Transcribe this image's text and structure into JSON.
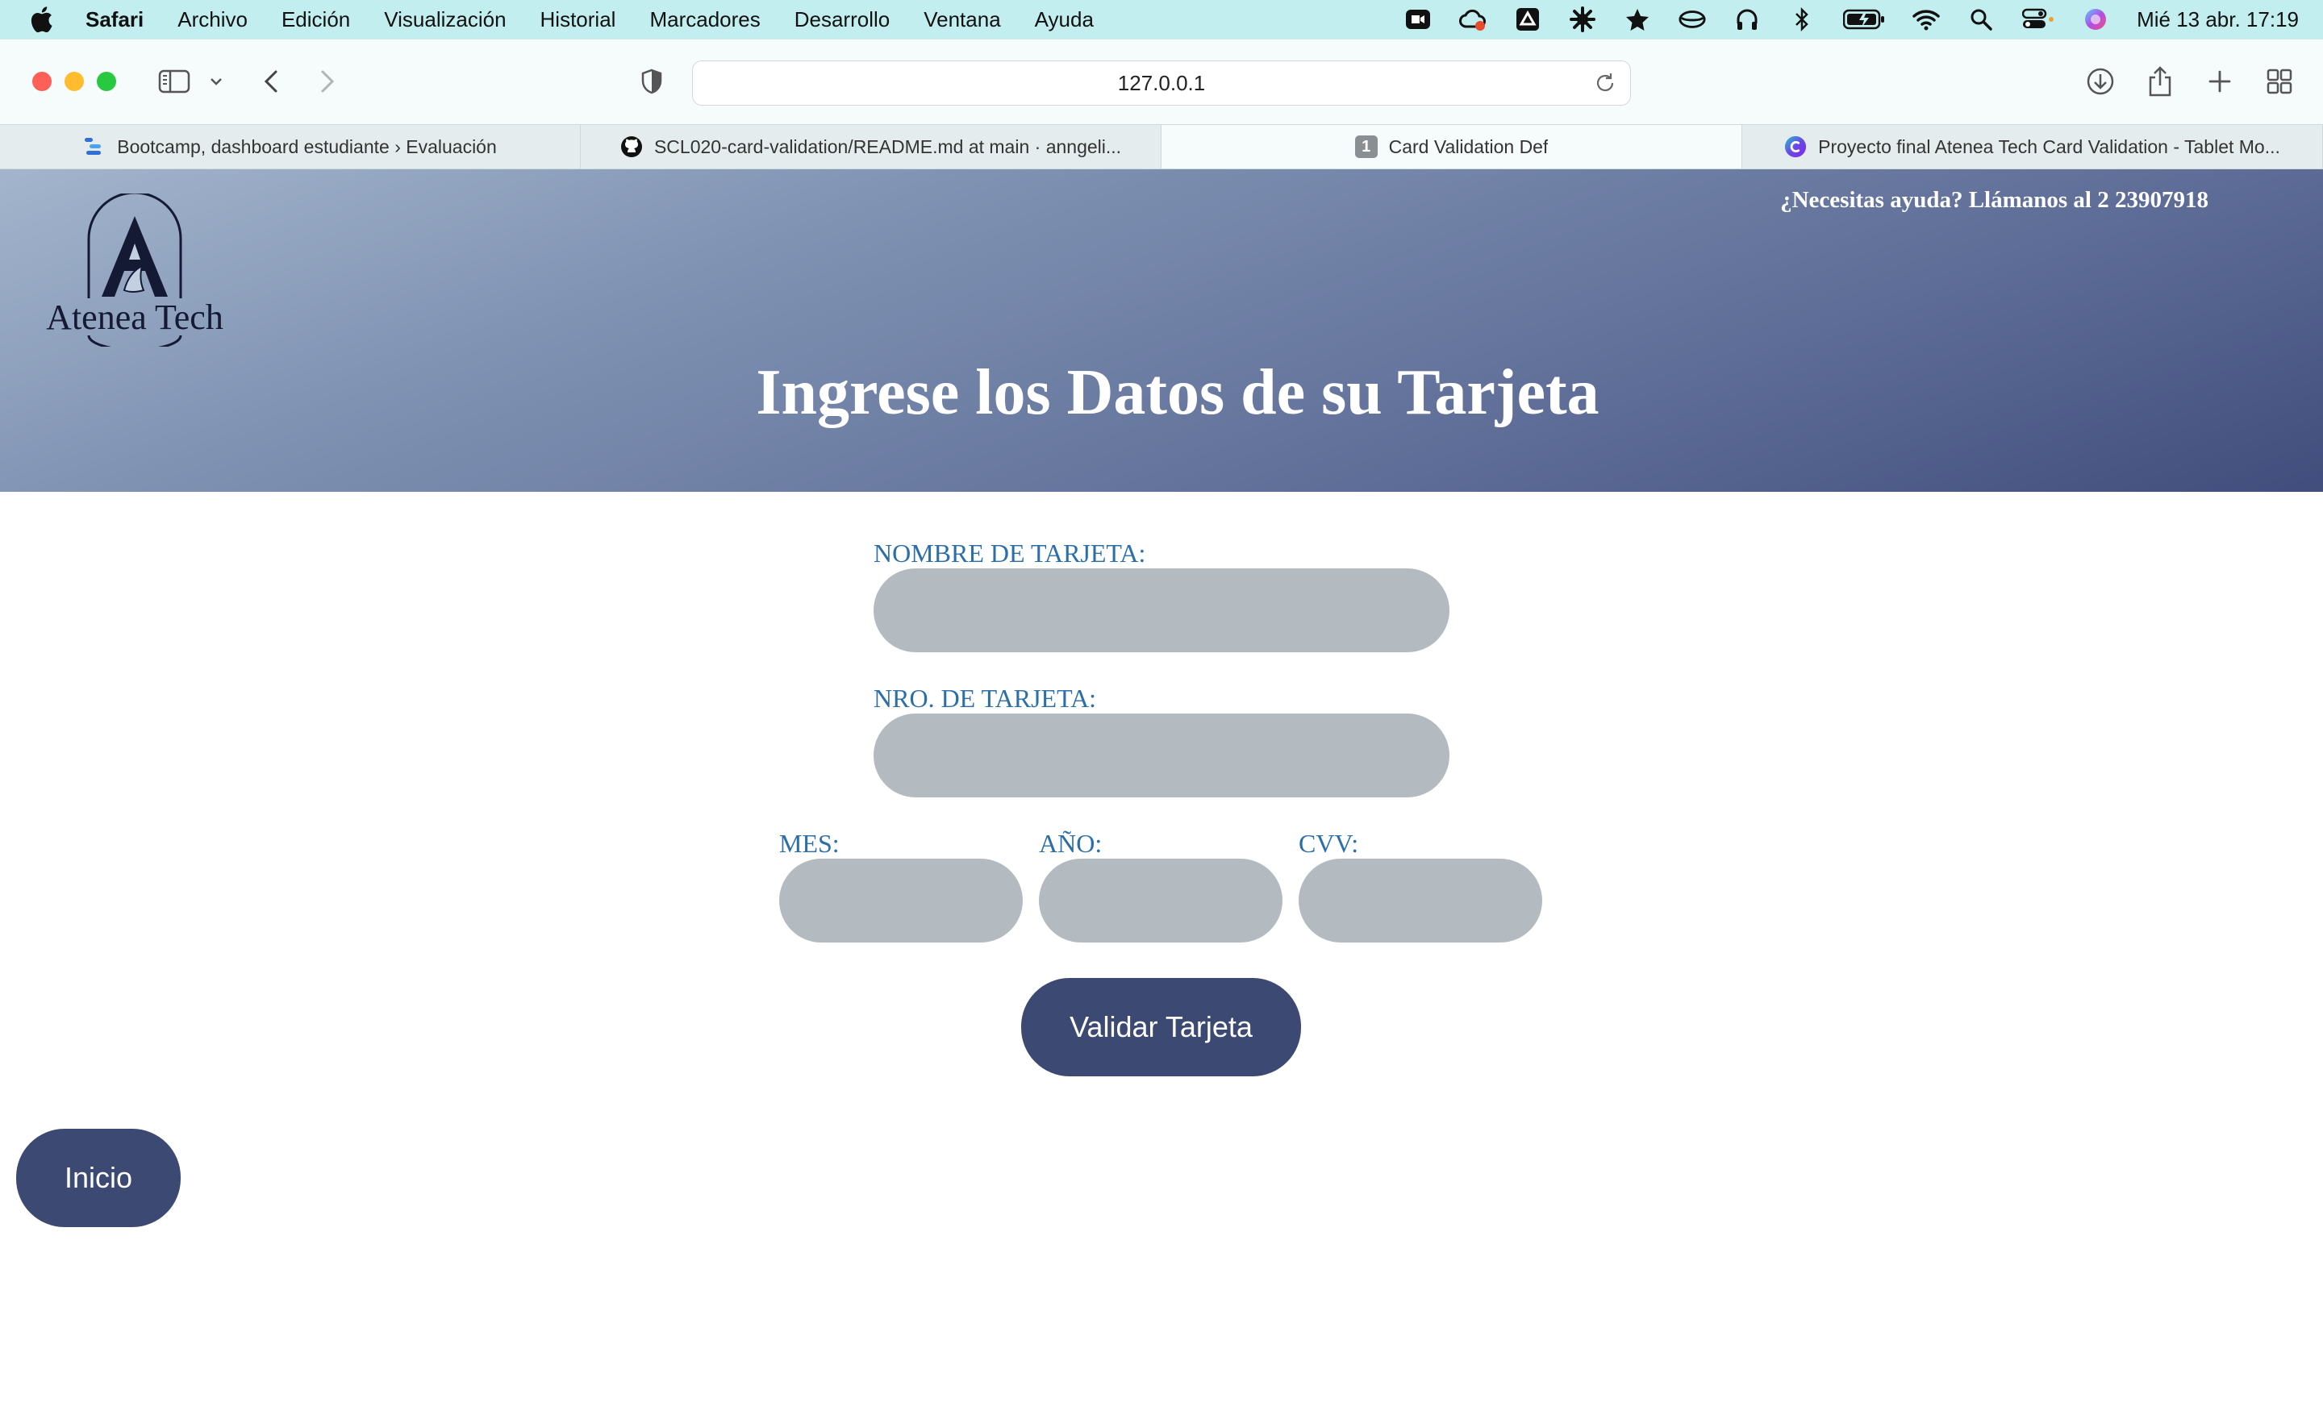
{
  "menubar": {
    "app_name": "Safari",
    "items": [
      "Archivo",
      "Edición",
      "Visualización",
      "Historial",
      "Marcadores",
      "Desarrollo",
      "Ventana",
      "Ayuda"
    ],
    "clock": "Mié 13 abr.  17:19",
    "status_icons": [
      "zoom-video-icon",
      "creative-cloud-icon",
      "google-drive-icon",
      "settings-gear-icon",
      "star-icon",
      "headset-icon",
      "headphones-icon",
      "bluetooth-icon",
      "battery-icon",
      "wifi-icon",
      "spotlight-search-icon",
      "control-center-icon",
      "siri-icon"
    ]
  },
  "browser": {
    "address": "127.0.0.1",
    "tabs": [
      {
        "label": "Bootcamp, dashboard estudiante › Evaluación",
        "icon": "bootcamp-icon",
        "active": false
      },
      {
        "label": "SCL020-card-validation/README.md at main · anngeli...",
        "icon": "github-icon",
        "active": false
      },
      {
        "label": "Card Validation Def",
        "icon": "number-1-icon",
        "active": true,
        "badge": "1"
      },
      {
        "label": "Proyecto final Atenea Tech Card Validation - Tablet Mo...",
        "icon": "canva-icon",
        "active": false
      }
    ]
  },
  "page": {
    "logo_text": "Atenea Tech",
    "help_text": "¿Necesitas ayuda? Llámanos al 2 23907918",
    "title": "Ingrese los Datos de su Tarjeta",
    "form": {
      "card_name_label": "NOMBRE DE TARJETA:",
      "card_name_value": "",
      "card_number_label": "NRO. DE TARJETA:",
      "card_number_value": "",
      "month_label": "MES:",
      "month_value": "",
      "year_label": "AÑO:",
      "year_value": "",
      "cvv_label": "CVV:",
      "cvv_value": "",
      "validate_button": "Validar Tarjeta"
    },
    "home_button": "Inicio"
  },
  "colors": {
    "menubar_bg": "#c3eef0",
    "header_gradient_start": "#a3b5cc",
    "header_gradient_end": "#414d7c",
    "label_color": "#2b6ea8",
    "input_bg": "#b3bac0",
    "button_bg": "#3c4a73"
  }
}
